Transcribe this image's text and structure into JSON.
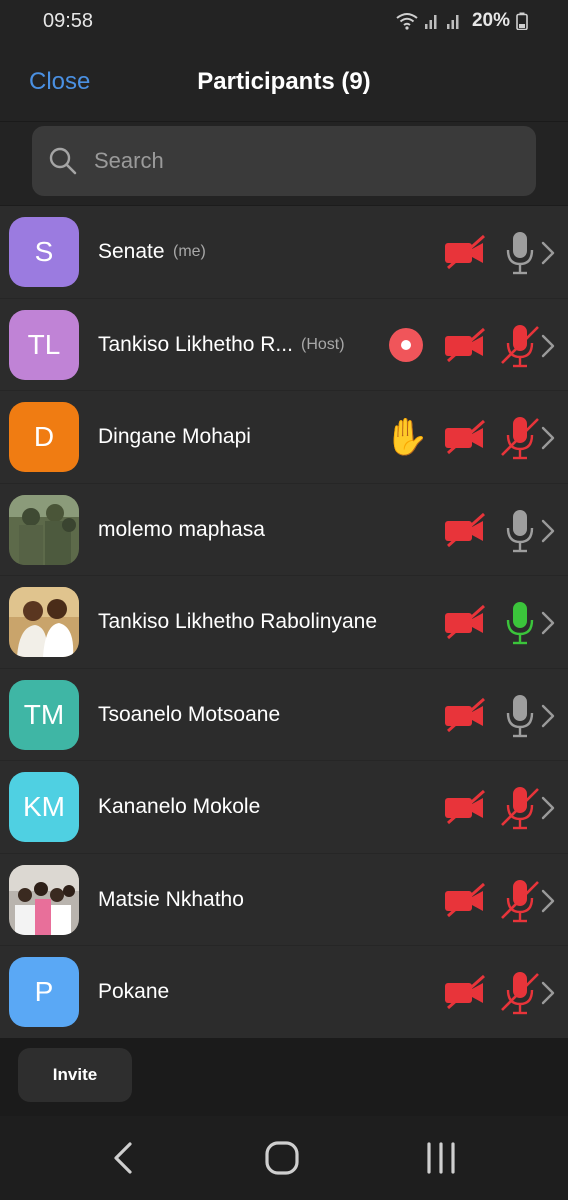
{
  "status_bar": {
    "time": "09:58",
    "battery": "20%"
  },
  "header": {
    "close_label": "Close",
    "title": "Participants (9)"
  },
  "search": {
    "placeholder": "Search",
    "value": ""
  },
  "participants": [
    {
      "initials": "S",
      "avatar_color": "#9b7be0",
      "name": "Senate",
      "tag": "(me)",
      "video": "off",
      "mic": "on-idle"
    },
    {
      "initials": "TL",
      "avatar_color": "#c083d6",
      "name": "Tankiso Likhetho R...",
      "tag": "(Host)",
      "recording": true,
      "video": "off",
      "mic": "muted"
    },
    {
      "initials": "D",
      "avatar_color": "#f07c12",
      "name": "Dingane Mohapi",
      "hand_raised": true,
      "hand_glyph": "✋",
      "video": "off",
      "mic": "muted"
    },
    {
      "initials": "",
      "avatar_photo": "photo-avatar-soldiers",
      "name": "molemo maphasa",
      "video": "off",
      "mic": "on-idle"
    },
    {
      "initials": "",
      "avatar_photo": "photo-avatar-couple",
      "name": "Tankiso Likhetho Rabolinyane",
      "video": "off",
      "mic": "speaking"
    },
    {
      "initials": "TM",
      "avatar_color": "#3fb6a5",
      "name": "Tsoanelo Motsoane",
      "video": "off",
      "mic": "on-idle"
    },
    {
      "initials": "KM",
      "avatar_color": "#4fd0e2",
      "name": "Kananelo Mokole",
      "video": "off",
      "mic": "muted"
    },
    {
      "initials": "",
      "avatar_photo": "photo-avatar-group",
      "name": "Matsie Nkhatho",
      "video": "off",
      "mic": "muted"
    },
    {
      "initials": "P",
      "avatar_color": "#5aa8f5",
      "name": "Pokane",
      "video": "off",
      "mic": "muted"
    }
  ],
  "footer": {
    "invite_label": "Invite"
  },
  "colors": {
    "accent": "#4a90e2",
    "muted_red": "#e8343a",
    "speaking_green": "#3bc43b",
    "idle_gray": "#9e9e9e"
  }
}
